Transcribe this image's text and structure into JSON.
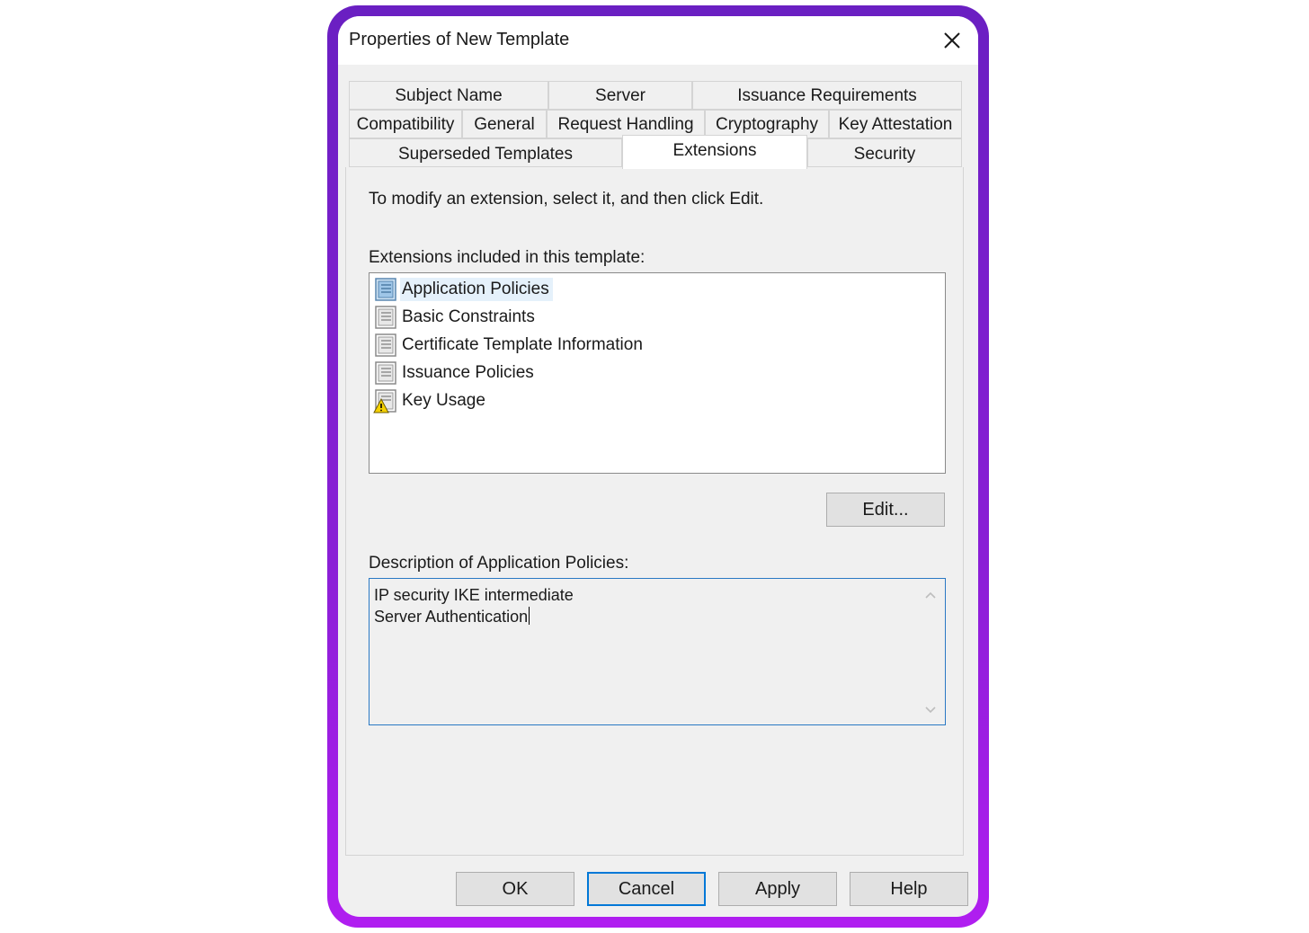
{
  "window": {
    "title": "Properties of New Template"
  },
  "tabs": {
    "row1": [
      "Subject Name",
      "Server",
      "Issuance Requirements"
    ],
    "row2": [
      "Compatibility",
      "General",
      "Request Handling",
      "Cryptography",
      "Key Attestation"
    ],
    "row3": [
      "Superseded Templates",
      "Extensions",
      "Security"
    ],
    "active": "Extensions"
  },
  "extensions": {
    "instruction": "To modify an extension, select it, and then click Edit.",
    "list_label": "Extensions included in this template:",
    "items": [
      {
        "label": "Application Policies",
        "icon": "extension-icon",
        "selected": true
      },
      {
        "label": "Basic Constraints",
        "icon": "extension-icon"
      },
      {
        "label": "Certificate Template Information",
        "icon": "extension-icon"
      },
      {
        "label": "Issuance Policies",
        "icon": "extension-icon"
      },
      {
        "label": "Key Usage",
        "icon": "warning-extension-icon"
      }
    ],
    "edit_label": "Edit...",
    "description_label": "Description of Application Policies:",
    "description_lines": [
      "IP security IKE intermediate",
      "Server Authentication"
    ]
  },
  "buttons": {
    "ok": "OK",
    "cancel": "Cancel",
    "apply": "Apply",
    "help": "Help"
  },
  "colors": {
    "frame_start": "#6a1fc2",
    "frame_end": "#b01ef0",
    "focus_blue": "#0078d7"
  }
}
